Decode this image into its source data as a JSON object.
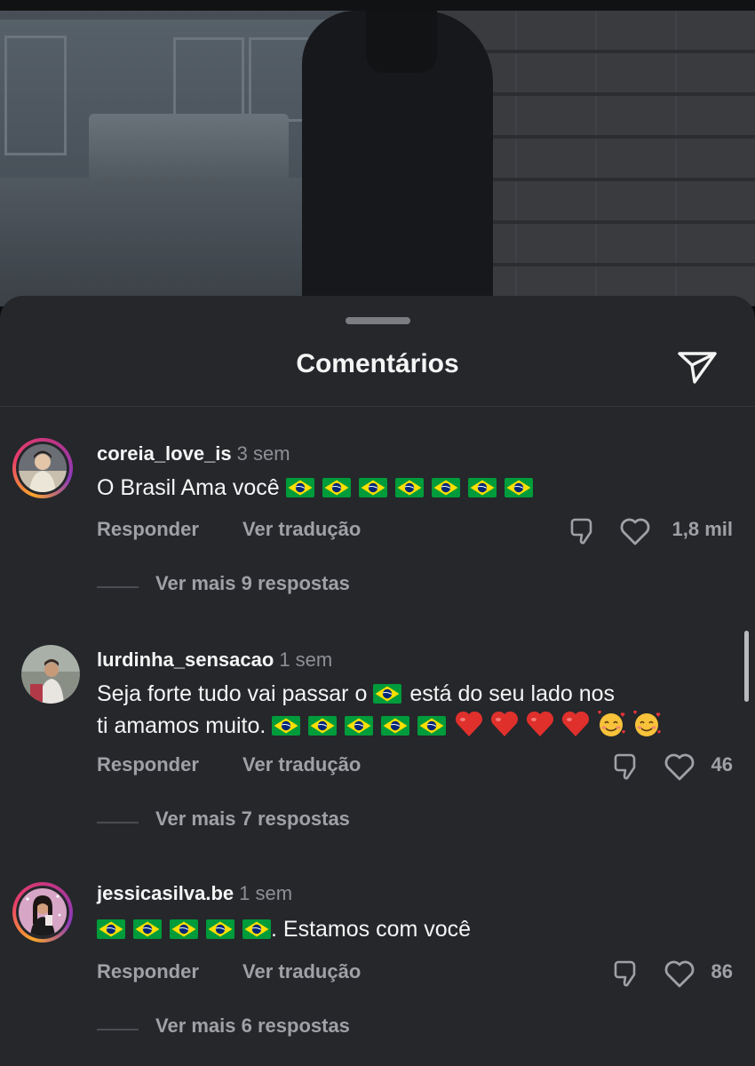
{
  "sheet": {
    "title": "Comentários",
    "send_icon": "send-icon"
  },
  "comments": [
    {
      "username": "coreia_love_is",
      "time": "3 sem",
      "text_prefix": "O Brasil Ama você",
      "flag_count": 7,
      "reply_label": "Responder",
      "translate_label": "Ver tradução",
      "likes": "1,8 mil",
      "more_replies": "Ver mais 9 respostas",
      "has_story_ring": true
    },
    {
      "username": "lurdinha_sensacao",
      "time": "1 sem",
      "line1_a": "Seja forte  tudo vai passar o",
      "line1_b": "está do seu lado nos",
      "line2_a": "ti amamos  muito.",
      "reply_label": "Responder",
      "translate_label": "Ver tradução",
      "likes": "46",
      "more_replies": "Ver mais 7 respostas",
      "has_story_ring": false
    },
    {
      "username": "jessicasilva.be",
      "time": "1 sem",
      "text_suffix": ". Estamos com você",
      "flag_count": 5,
      "reply_label": "Responder",
      "translate_label": "Ver tradução",
      "likes": "86",
      "more_replies": "Ver mais 6 respostas",
      "has_story_ring": true
    }
  ],
  "colors": {
    "sheet_bg": "#25272b",
    "muted_text": "#9fa1a6",
    "brazil_green": "#009b3a",
    "brazil_yellow": "#fedf00",
    "brazil_blue": "#002776"
  }
}
